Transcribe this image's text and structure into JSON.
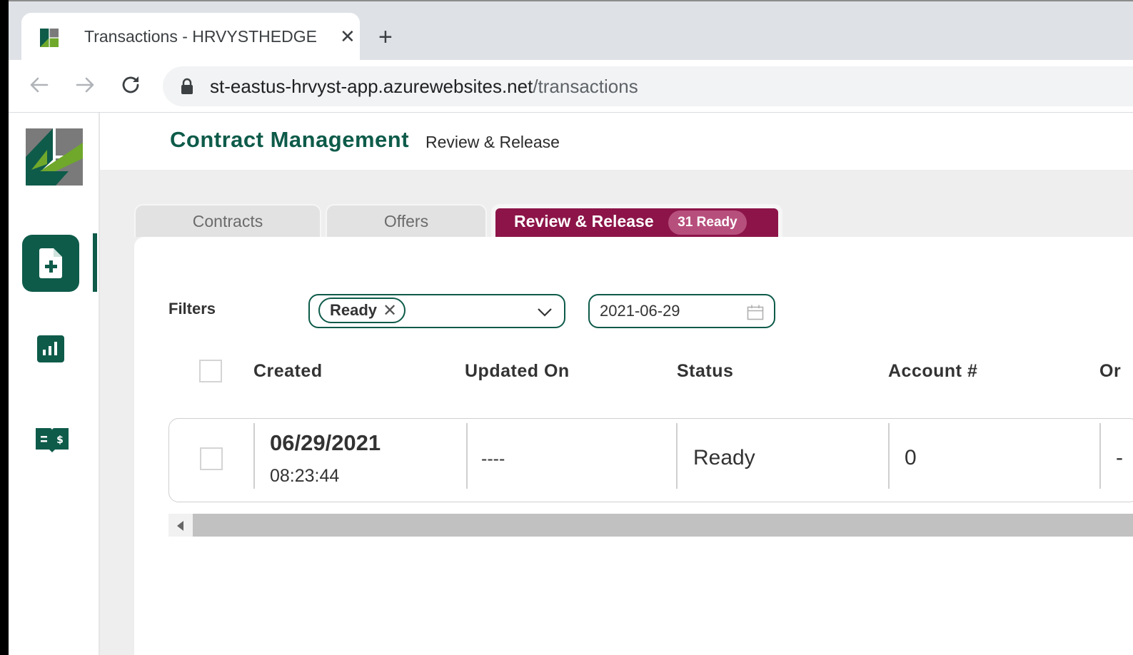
{
  "browser": {
    "tab_title": "Transactions - HRVYSTHEDGE",
    "close_glyph": "✕",
    "newtab_glyph": "+",
    "url_host": "st-eastus-hrvyst-app.azurewebsites.net",
    "url_path": "/transactions"
  },
  "header": {
    "title": "Contract Management",
    "subtitle": "Review & Release"
  },
  "tabs": [
    {
      "label": "Contracts"
    },
    {
      "label": "Offers"
    },
    {
      "label": "Review & Release",
      "badge": "31 Ready"
    }
  ],
  "filters": {
    "label": "Filters",
    "status_chip": "Ready",
    "chip_remove": "✕",
    "date": "2021-06-29"
  },
  "table": {
    "columns": [
      "Created",
      "Updated On",
      "Status",
      "Account #",
      "Or"
    ],
    "rows": [
      {
        "created_date": "06/29/2021",
        "created_time": "08:23:44",
        "updated_on": "----",
        "status": "Ready",
        "account": "0",
        "next": "-"
      }
    ]
  },
  "colors": {
    "brand_green": "#0e5b4a",
    "accent_magenta": "#8c1448",
    "logo_lime": "#6fa82b",
    "logo_gray": "#7a7a7a"
  },
  "icons": {
    "sidebar": [
      "new-contract-icon",
      "analytics-icon",
      "ledger-icon"
    ],
    "browser": [
      "back-icon",
      "forward-icon",
      "reload-icon",
      "lock-icon"
    ]
  }
}
